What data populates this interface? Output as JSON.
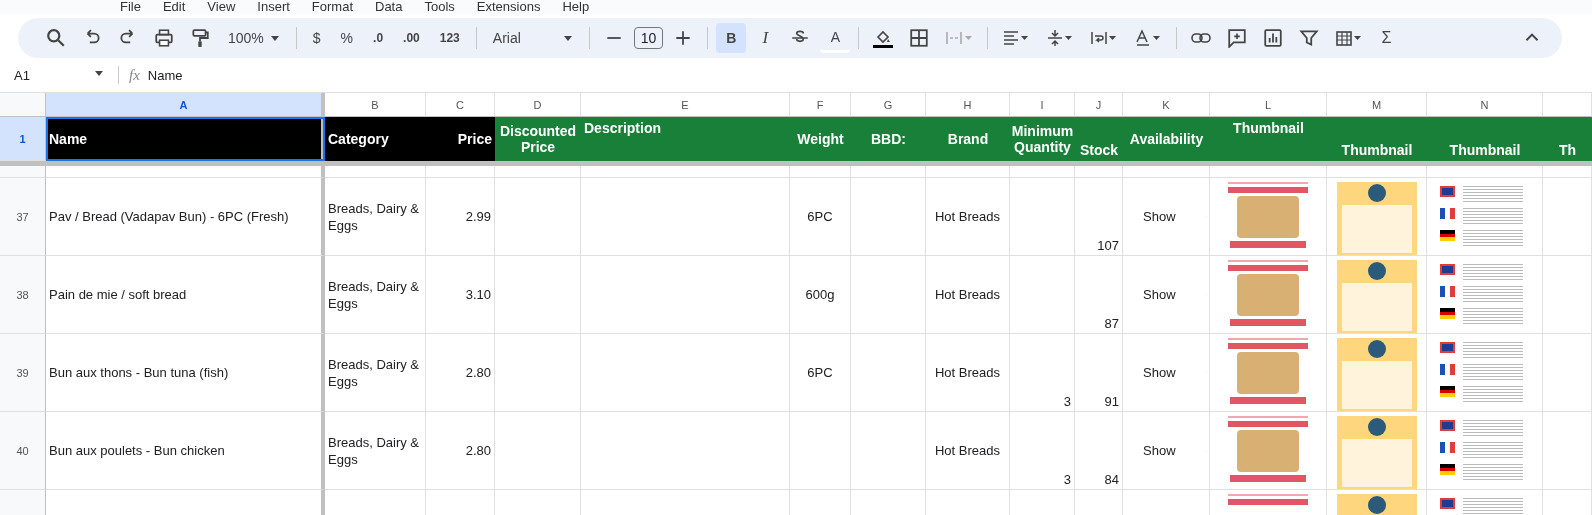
{
  "menu": [
    "File",
    "Edit",
    "View",
    "Insert",
    "Format",
    "Data",
    "Tools",
    "Extensions",
    "Help"
  ],
  "toolbar": {
    "zoom": "100%",
    "currency": "$",
    "percent": "%",
    "decrease_decimals": ".0",
    "increase_decimals": ".00",
    "number_format": "123",
    "font": "Arial",
    "font_size": "10",
    "bold": {
      "label": "B",
      "selected": true
    },
    "italic": {
      "label": "I",
      "selected": false
    },
    "text_color": "A",
    "sum": "Σ"
  },
  "formula_bar": {
    "cell_ref": "A1",
    "fx": "fx",
    "value": "Name"
  },
  "header_row": {
    "number": "1",
    "selected": true
  },
  "columns": [
    {
      "letter": "A",
      "selected": true,
      "header": "Name",
      "color": "#000000"
    },
    {
      "letter": "B",
      "selected": false,
      "header": "Category",
      "color": "#000000"
    },
    {
      "letter": "C",
      "selected": false,
      "header": "Price",
      "color": "#000000"
    },
    {
      "letter": "D",
      "selected": false,
      "header": "Discounted Price",
      "color": "#188038"
    },
    {
      "letter": "E",
      "selected": false,
      "header": "Description",
      "color": "#188038"
    },
    {
      "letter": "F",
      "selected": false,
      "header": "Weight",
      "color": "#188038"
    },
    {
      "letter": "G",
      "selected": false,
      "header": "BBD:",
      "color": "#188038"
    },
    {
      "letter": "H",
      "selected": false,
      "header": "Brand",
      "color": "#188038"
    },
    {
      "letter": "I",
      "selected": false,
      "header": "Minimum Quantity",
      "color": "#188038"
    },
    {
      "letter": "J",
      "selected": false,
      "header": "Stock",
      "color": "#188038"
    },
    {
      "letter": "K",
      "selected": false,
      "header": "Availability",
      "color": "#188038"
    },
    {
      "letter": "L",
      "selected": false,
      "header": "Thumbnail",
      "color": "#188038"
    },
    {
      "letter": "M",
      "selected": false,
      "header": "Thumbnail",
      "color": "#188038"
    },
    {
      "letter": "N",
      "selected": false,
      "header": "Thumbnail",
      "color": "#188038"
    },
    {
      "selected": false,
      "header": "Th",
      "color": "#188038"
    }
  ],
  "rows": [
    {
      "number": "37",
      "name": "Pav / Bread (Vadapav Bun) - 6PC (Fresh)",
      "category": "Breads, Dairy & Eggs",
      "price": "2.99",
      "weight": "6PC",
      "brand": "Hot Breads",
      "stock": "107",
      "availability": "Show"
    },
    {
      "number": "38",
      "name": "Pain de mie / soft bread",
      "category": "Breads, Dairy & Eggs",
      "price": "3.10",
      "weight": "600g",
      "brand": "Hot Breads",
      "stock": "87",
      "availability": "Show"
    },
    {
      "number": "39",
      "name": "Bun aux thons - Bun tuna (fish)",
      "category": "Breads, Dairy & Eggs",
      "price": "2.80",
      "weight": "6PC",
      "brand": "Hot Breads",
      "minimum_quantity": "3",
      "stock": "91",
      "availability": "Show"
    },
    {
      "number": "40",
      "name": "Bun aux poulets - Bun chicken",
      "category": "Breads, Dairy & Eggs",
      "price": "2.80",
      "weight": "",
      "brand": "Hot Breads",
      "minimum_quantity": "3",
      "stock": "84",
      "availability": "Show"
    }
  ]
}
